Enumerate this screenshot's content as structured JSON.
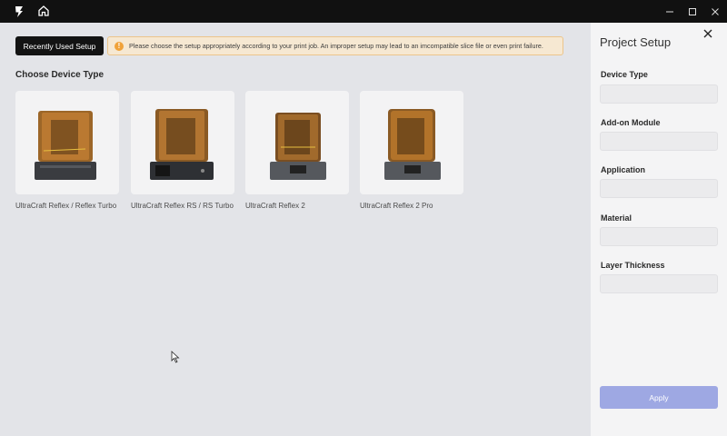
{
  "titlebar": {
    "logo_letter": "E"
  },
  "main": {
    "recent_button": "Recently Used Setup",
    "warning_icon": "!",
    "warning_text": "Please choose the setup appropriately according to your print job. An improper setup may lead to an imcompatible slice file or even print failure.",
    "section_title": "Choose Device Type",
    "devices": [
      {
        "label": "UltraCraft Reflex / Reflex Turbo"
      },
      {
        "label": "UltraCraft Reflex RS / RS Turbo"
      },
      {
        "label": "UltraCraft Reflex 2"
      },
      {
        "label": "UltraCraft Reflex 2 Pro"
      }
    ]
  },
  "panel": {
    "title": "Project Setup",
    "fields": [
      {
        "label": "Device Type",
        "value": ""
      },
      {
        "label": "Add-on Module",
        "value": ""
      },
      {
        "label": "Application",
        "value": ""
      },
      {
        "label": "Material",
        "value": ""
      },
      {
        "label": "Layer Thickness",
        "value": ""
      }
    ],
    "apply_button": "Apply"
  },
  "colors": {
    "titlebar": "#111111",
    "warning_bg": "#f6e8d2",
    "warning_icon": "#f0a23a",
    "apply_disabled": "#9ea8e3",
    "resin_cover": "#b8782c"
  }
}
